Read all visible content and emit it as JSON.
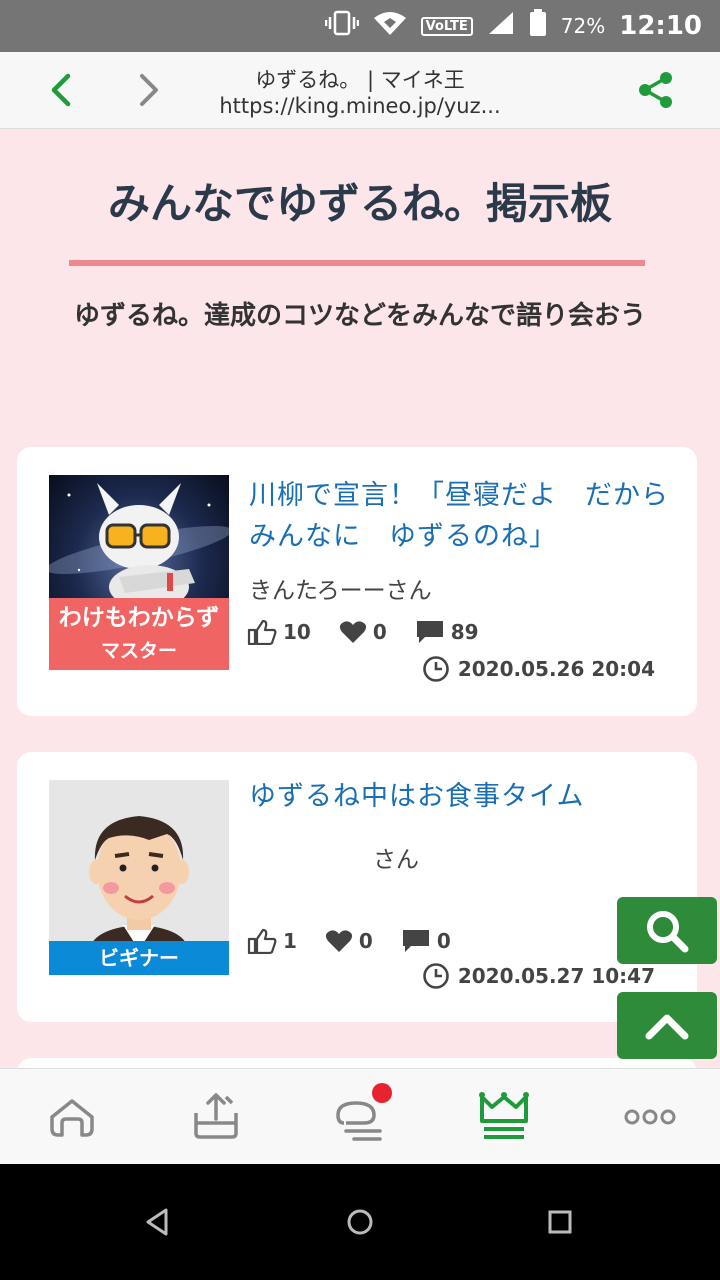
{
  "status_bar": {
    "battery": "72%",
    "time": "12:10",
    "volte": "VoLTE"
  },
  "browser": {
    "page_title": "ゆずるね。 | マイネ王",
    "url": "https://king.mineo.jp/yuz..."
  },
  "page": {
    "title": "みんなでゆずるね。掲示板",
    "subtitle": "ゆずるね。達成のコツなどをみんなで語り会おう"
  },
  "posts": [
    {
      "title": "川柳で宣言！「昼寝だよ　だからみんなに　ゆずるのね」",
      "author": "きんたろーーさん",
      "likes": "10",
      "hearts": "0",
      "comments": "89",
      "date": "2020.05.26 20:04",
      "rank_line1": "わけもわからず",
      "rank_line2": "マスター"
    },
    {
      "title": "ゆずるね中はお食事タイム",
      "author": "さん",
      "likes": "1",
      "hearts": "0",
      "comments": "0",
      "date": "2020.05.27 10:47",
      "rank": "ビギナー"
    }
  ],
  "colors": {
    "accent_green": "#2e8b3a",
    "link_blue": "#1a6fb4",
    "page_bg": "#fde6ea",
    "rule_pink": "#ee8a8c"
  },
  "icons": {
    "back": "chevron-left-icon",
    "forward": "chevron-right-icon",
    "share": "share-icon",
    "search": "search-icon",
    "scroll_top": "chevron-up-icon",
    "nav": [
      "home-icon",
      "upload-icon",
      "chat-icon",
      "crown-icon",
      "more-icon"
    ]
  }
}
